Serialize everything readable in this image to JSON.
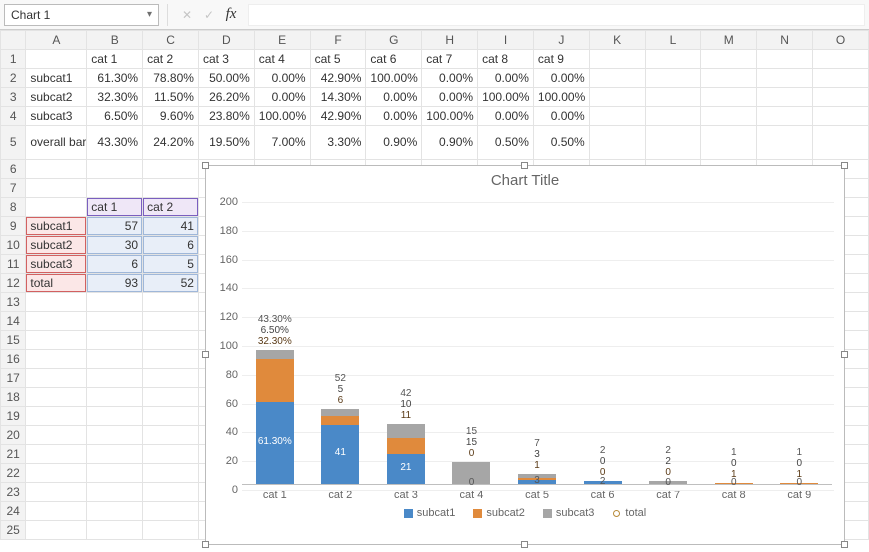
{
  "toolbar": {
    "namebox": "Chart 1",
    "fx_label": "fx"
  },
  "columns": [
    "A",
    "B",
    "C",
    "D",
    "E",
    "F",
    "G",
    "H",
    "I",
    "J",
    "K",
    "L",
    "M",
    "N",
    "O"
  ],
  "row1": [
    "",
    "cat 1",
    "cat 2",
    "cat 3",
    "cat 4",
    "cat 5",
    "cat 6",
    "cat 7",
    "cat 8",
    "cat 9",
    "",
    "",
    "",
    "",
    ""
  ],
  "row2": [
    "subcat1",
    "61.30%",
    "78.80%",
    "50.00%",
    "0.00%",
    "42.90%",
    "100.00%",
    "0.00%",
    "0.00%",
    "0.00%",
    "",
    "",
    "",
    "",
    ""
  ],
  "row3": [
    "subcat2",
    "32.30%",
    "11.50%",
    "26.20%",
    "0.00%",
    "14.30%",
    "0.00%",
    "0.00%",
    "100.00%",
    "100.00%",
    "",
    "",
    "",
    "",
    ""
  ],
  "row4": [
    "subcat3",
    "6.50%",
    "9.60%",
    "23.80%",
    "100.00%",
    "42.90%",
    "0.00%",
    "100.00%",
    "0.00%",
    "0.00%",
    "",
    "",
    "",
    "",
    ""
  ],
  "row5": [
    "overall bar total",
    "43.30%",
    "24.20%",
    "19.50%",
    "7.00%",
    "3.30%",
    "0.90%",
    "0.90%",
    "0.50%",
    "0.50%",
    "",
    "",
    "",
    "",
    ""
  ],
  "row8": [
    "",
    "cat 1",
    "cat 2",
    "",
    "",
    "",
    "",
    "",
    "",
    "",
    "",
    "",
    "",
    "",
    ""
  ],
  "row9": [
    "subcat1",
    "57",
    "41",
    "",
    "",
    "",
    "",
    "",
    "",
    "",
    "",
    "",
    "",
    "",
    ""
  ],
  "row10": [
    "subcat2",
    "30",
    "6",
    "",
    "",
    "",
    "",
    "",
    "",
    "",
    "",
    "",
    "",
    "",
    ""
  ],
  "row11": [
    "subcat3",
    "6",
    "5",
    "",
    "",
    "",
    "",
    "",
    "",
    "",
    "",
    "",
    "",
    "",
    ""
  ],
  "row12": [
    "total",
    "93",
    "52",
    "",
    "",
    "",
    "",
    "",
    "",
    "",
    "",
    "",
    "",
    "",
    ""
  ],
  "blank_rows": [
    6,
    7,
    13,
    14,
    15,
    16,
    17,
    18,
    19,
    20,
    21,
    22,
    23,
    24,
    25
  ],
  "chart": {
    "title": "Chart Title",
    "ylabels": [
      "0",
      "20",
      "40",
      "60",
      "80",
      "100",
      "120",
      "140",
      "160",
      "180",
      "200"
    ],
    "categories": [
      "cat 1",
      "cat 2",
      "cat 3",
      "cat 4",
      "cat 5",
      "cat 6",
      "cat 7",
      "cat 8",
      "cat 9"
    ],
    "legend": [
      "subcat1",
      "subcat2",
      "subcat3",
      "total"
    ]
  },
  "chart_data": {
    "type": "bar",
    "stacked": true,
    "title": "Chart Title",
    "ylim": [
      0,
      200
    ],
    "ystep": 20,
    "categories": [
      "cat 1",
      "cat 2",
      "cat 3",
      "cat 4",
      "cat 5",
      "cat 6",
      "cat 7",
      "cat 8",
      "cat 9"
    ],
    "series": [
      {
        "name": "subcat1",
        "values": [
          57,
          41,
          21,
          0,
          3,
          2,
          0,
          0,
          0
        ],
        "data_labels": [
          "61.30%",
          "41",
          "21",
          "0",
          "3",
          "2",
          "0",
          "0",
          "0"
        ]
      },
      {
        "name": "subcat2",
        "values": [
          30,
          6,
          11,
          0,
          1,
          0,
          0,
          1,
          1
        ],
        "data_labels": [
          "32.30%",
          "6",
          "11",
          "0",
          "1",
          "0",
          "0",
          "1",
          "1"
        ]
      },
      {
        "name": "subcat3",
        "values": [
          6,
          5,
          10,
          15,
          3,
          0,
          2,
          0,
          0
        ],
        "data_labels": [
          "6.50%",
          "5",
          "10",
          "15",
          "3",
          "0",
          "2",
          "0",
          "0"
        ]
      },
      {
        "name": "total",
        "values": [
          93,
          52,
          42,
          15,
          7,
          2,
          2,
          1,
          1
        ],
        "data_labels": [
          "43.30%",
          "52",
          "42",
          "15",
          "7",
          "2",
          "2",
          "1",
          "1"
        ]
      }
    ]
  }
}
